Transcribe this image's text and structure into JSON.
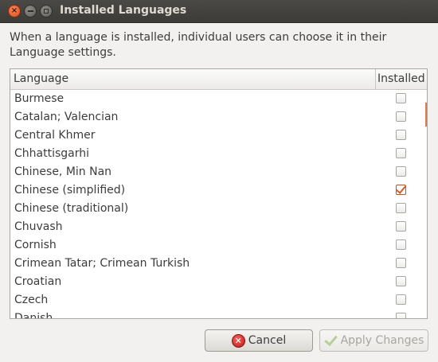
{
  "window": {
    "title": "Installed Languages",
    "close_glyph": "×"
  },
  "description": "When a language is installed, individual users can choose it in their Language settings.",
  "list": {
    "columns": {
      "language": "Language",
      "installed": "Installed"
    },
    "rows": [
      {
        "language": "Burmese",
        "installed": false
      },
      {
        "language": "Catalan; Valencian",
        "installed": false
      },
      {
        "language": "Central Khmer",
        "installed": false
      },
      {
        "language": "Chhattisgarhi",
        "installed": false
      },
      {
        "language": "Chinese, Min Nan",
        "installed": false
      },
      {
        "language": "Chinese (simplified)",
        "installed": true
      },
      {
        "language": "Chinese (traditional)",
        "installed": false
      },
      {
        "language": "Chuvash",
        "installed": false
      },
      {
        "language": "Cornish",
        "installed": false
      },
      {
        "language": "Crimean Tatar; Crimean Turkish",
        "installed": false
      },
      {
        "language": "Croatian",
        "installed": false
      },
      {
        "language": "Czech",
        "installed": false
      },
      {
        "language": "Danish",
        "installed": false
      }
    ]
  },
  "buttons": {
    "cancel": {
      "label": "Cancel",
      "icon": "cancel-icon",
      "icon_glyph": "✕"
    },
    "apply": {
      "label": "Apply Changes",
      "icon": "checkmark-icon",
      "enabled": false
    }
  },
  "colors": {
    "accent": "#dd4814",
    "check": "#d95b22"
  }
}
